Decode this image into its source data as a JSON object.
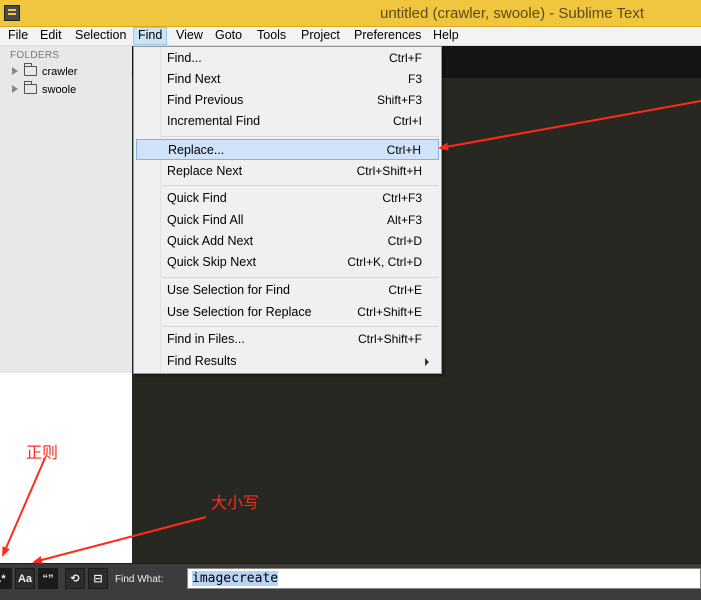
{
  "window": {
    "title": "untitled (crawler, swoole) - Sublime Text"
  },
  "menubar": {
    "items": [
      "File",
      "Edit",
      "Selection",
      "Find",
      "View",
      "Goto",
      "Tools",
      "Project",
      "Preferences",
      "Help"
    ],
    "active": "Find"
  },
  "sidebar": {
    "header": "FOLDERS",
    "folders": [
      "crawler",
      "swoole"
    ]
  },
  "find_menu": {
    "items": [
      {
        "label": "Find...",
        "shortcut": "Ctrl+F"
      },
      {
        "label": "Find Next",
        "shortcut": "F3"
      },
      {
        "label": "Find Previous",
        "shortcut": "Shift+F3"
      },
      {
        "label": "Incremental Find",
        "shortcut": "Ctrl+I"
      },
      {
        "label": "Replace...",
        "shortcut": "Ctrl+H",
        "highlighted": true
      },
      {
        "label": "Replace Next",
        "shortcut": "Ctrl+Shift+H"
      },
      {
        "label": "Quick Find",
        "shortcut": "Ctrl+F3"
      },
      {
        "label": "Quick Find All",
        "shortcut": "Alt+F3"
      },
      {
        "label": "Quick Add Next",
        "shortcut": "Ctrl+D"
      },
      {
        "label": "Quick Skip Next",
        "shortcut": "Ctrl+K, Ctrl+D"
      },
      {
        "label": "Use Selection for Find",
        "shortcut": "Ctrl+E"
      },
      {
        "label": "Use Selection for Replace",
        "shortcut": "Ctrl+Shift+E"
      },
      {
        "label": "Find in Files...",
        "shortcut": "Ctrl+Shift+F"
      },
      {
        "label": "Find Results",
        "shortcut": ""
      }
    ]
  },
  "find_panel": {
    "buttons": {
      "regex": ".*",
      "case": "Aa",
      "whole_word": "“”",
      "wrap": "⟲",
      "in_selection": "⊟"
    },
    "find_what_label": "Find What:",
    "find_value": "imagecreate"
  },
  "annotations": {
    "regex_label": "正则",
    "case_label": "大小写"
  },
  "colors": {
    "titlebar": "#f1c63f",
    "editor_bg": "#272822",
    "tab_bar_bg": "#141414",
    "menu_highlight": "#d1e3f8",
    "annotation": "#ff2a1a"
  }
}
